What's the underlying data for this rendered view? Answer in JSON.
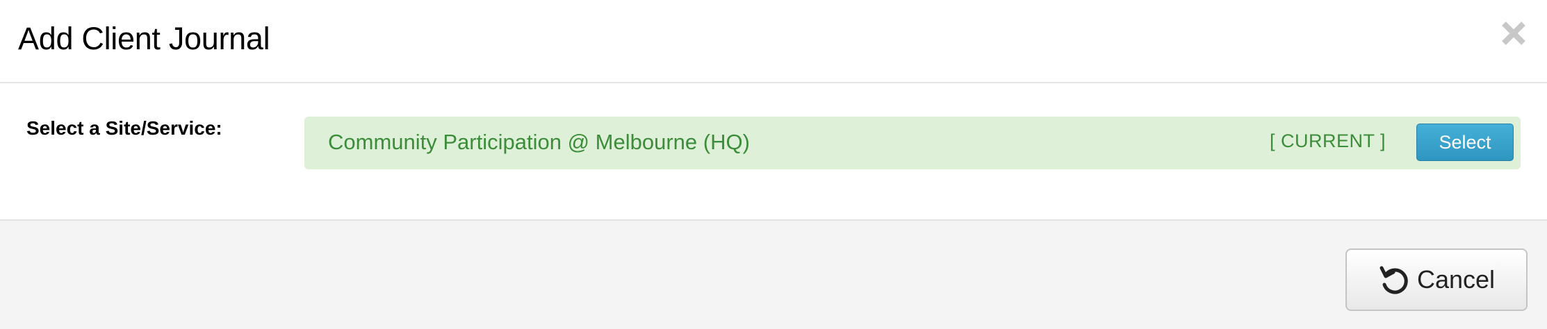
{
  "modal": {
    "title": "Add Client Journal",
    "close_icon": "close-icon"
  },
  "body": {
    "field_label": "Select a Site/Service:",
    "site": {
      "name": "Community Participation @ Melbourne (HQ)",
      "status": "[ CURRENT ]",
      "select_label": "Select"
    }
  },
  "footer": {
    "cancel_label": "Cancel",
    "cancel_icon": "undo-icon"
  },
  "colors": {
    "site_row_bg": "#dff0d8",
    "site_text": "#3c8d3a",
    "select_button": "#35a0cc",
    "footer_bg": "#f4f4f4"
  }
}
